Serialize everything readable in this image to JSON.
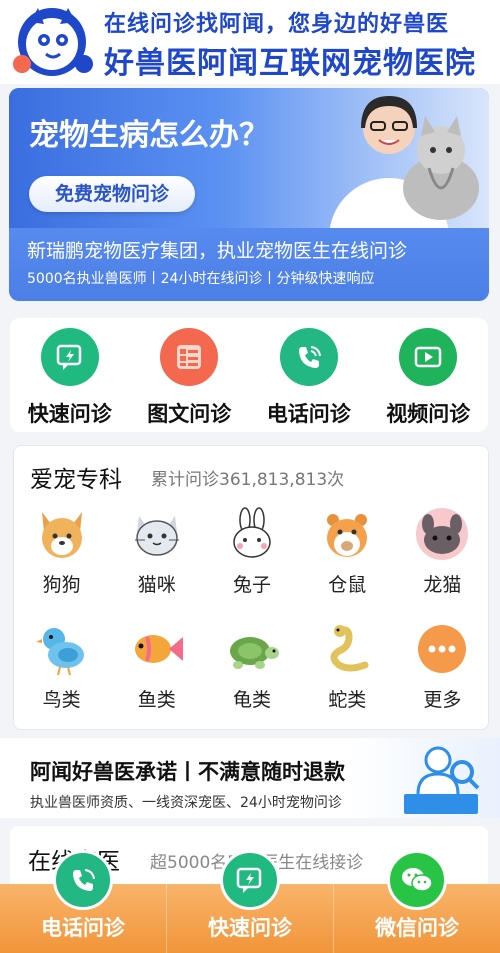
{
  "header": {
    "slogan": "在线问诊找阿闻，您身边的好兽医",
    "brand": "好兽医阿闻互联网宠物医院"
  },
  "banner": {
    "title": "宠物生病怎么办？",
    "button_label": "免费宠物问诊",
    "line1": "新瑞鹏宠物医疗集团，执业宠物医生在线问诊",
    "line2": "5000名执业兽医师丨24小时在线问诊丨分钟级快速响应"
  },
  "actions": [
    {
      "label": "快速问诊",
      "icon": "quick-consult-icon",
      "color": "#20b980"
    },
    {
      "label": "图文问诊",
      "icon": "image-text-icon",
      "color": "#f3684f"
    },
    {
      "label": "电话问诊",
      "icon": "phone-icon",
      "color": "#22b783"
    },
    {
      "label": "视频问诊",
      "icon": "video-icon",
      "color": "#1fb35c"
    }
  ],
  "specialty": {
    "title": "爱宠专科",
    "count_text": "累计问诊361,813,813次",
    "pets": [
      {
        "label": "狗狗",
        "icon": "dog-icon"
      },
      {
        "label": "猫咪",
        "icon": "cat-icon"
      },
      {
        "label": "兔子",
        "icon": "rabbit-icon"
      },
      {
        "label": "仓鼠",
        "icon": "hamster-icon"
      },
      {
        "label": "龙猫",
        "icon": "chinchilla-icon"
      },
      {
        "label": "鸟类",
        "icon": "bird-icon"
      },
      {
        "label": "鱼类",
        "icon": "fish-icon"
      },
      {
        "label": "龟类",
        "icon": "turtle-icon"
      },
      {
        "label": "蛇类",
        "icon": "snake-icon"
      },
      {
        "label": "更多",
        "icon": "more-icon"
      }
    ]
  },
  "promise": {
    "title": "阿闻好兽医承诺丨不满意随时退款",
    "subtitle": "执业兽医师资质、一线资深宠医、24小时宠物问诊"
  },
  "online": {
    "title": "在线宠医",
    "subtitle": "超5000名宠物医生在线接诊"
  },
  "bottom_bar": [
    {
      "label": "电话问诊",
      "icon": "phone-icon",
      "color": "#22b783"
    },
    {
      "label": "快速问诊",
      "icon": "quick-consult-icon",
      "color": "#20b980"
    },
    {
      "label": "微信问诊",
      "icon": "wechat-icon",
      "color": "#28c445"
    }
  ],
  "colors": {
    "brand_blue": "#1e47c9",
    "banner_blue": "#4a7ee8",
    "bottom_orange": "#f1953a"
  }
}
